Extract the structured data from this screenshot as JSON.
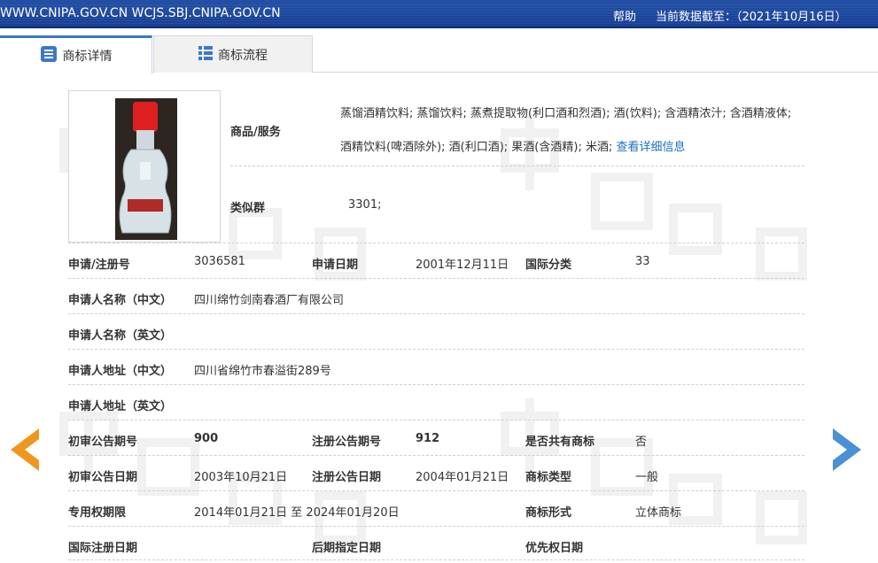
{
  "header": {
    "site_url": "WWW.CNIPA.GOV.CN WCJS.SBJ.CNIPA.GOV.CN",
    "help": "帮助",
    "data_date": "当前数据截至：（2021年10月16日）"
  },
  "tabs": [
    {
      "label": "商标详情",
      "icon": "document-list-icon",
      "active": true
    },
    {
      "label": "商标流程",
      "icon": "grid-list-icon",
      "active": false
    }
  ],
  "trademark_image": {
    "icon": "bottle-image"
  },
  "goods": {
    "label": "商品/服务",
    "text": "蒸馏酒精饮料; 蒸馏饮料; 蒸煮提取物(利口酒和烈酒); 酒(饮料); 含酒精浓汁; 含酒精液体; 酒精饮料(啤酒除外); 酒(利口酒); 果酒(含酒精); 米酒;",
    "detail_link": "查看详细信息"
  },
  "similar_group": {
    "label": "类似群",
    "value": "3301;"
  },
  "rows": {
    "reg_no_label": "申请/注册号",
    "reg_no": "3036581",
    "apply_date_label": "申请日期",
    "apply_date": "2001年12月11日",
    "intl_class_label": "国际分类",
    "intl_class": "33",
    "applicant_cn_label": "申请人名称（中文）",
    "applicant_cn": "四川绵竹剑南春酒厂有限公司",
    "applicant_en_label": "申请人名称（英文）",
    "applicant_en": "",
    "address_cn_label": "申请人地址（中文）",
    "address_cn": "四川省绵竹市春溢街289号",
    "address_en_label": "申请人地址（英文）",
    "address_en": "",
    "prelim_no_label": "初审公告期号",
    "prelim_no": "900",
    "reg_pub_no_label": "注册公告期号",
    "reg_pub_no": "912",
    "shared_label": "是否共有商标",
    "shared": "否",
    "prelim_date_label": "初审公告日期",
    "prelim_date": "2003年10月21日",
    "reg_pub_date_label": "注册公告日期",
    "reg_pub_date": "2004年01月21日",
    "tm_type_label": "商标类型",
    "tm_type": "一般",
    "exclusive_label": "专用权期限",
    "exclusive": "2014年01月21日 至 2024年01月20日",
    "tm_form_label": "商标形式",
    "tm_form": "立体商标",
    "intl_reg_date_label": "国际注册日期",
    "later_date_label": "后期指定日期",
    "priority_date_label": "优先权日期"
  },
  "nav": {
    "prev_icon": "arrow-left-icon",
    "next_icon": "arrow-right-icon"
  },
  "colors": {
    "topbar": "#1f4aa0",
    "prev_arrow": "#f0961e",
    "next_arrow": "#4a90d9",
    "link": "#1a6fc4"
  }
}
